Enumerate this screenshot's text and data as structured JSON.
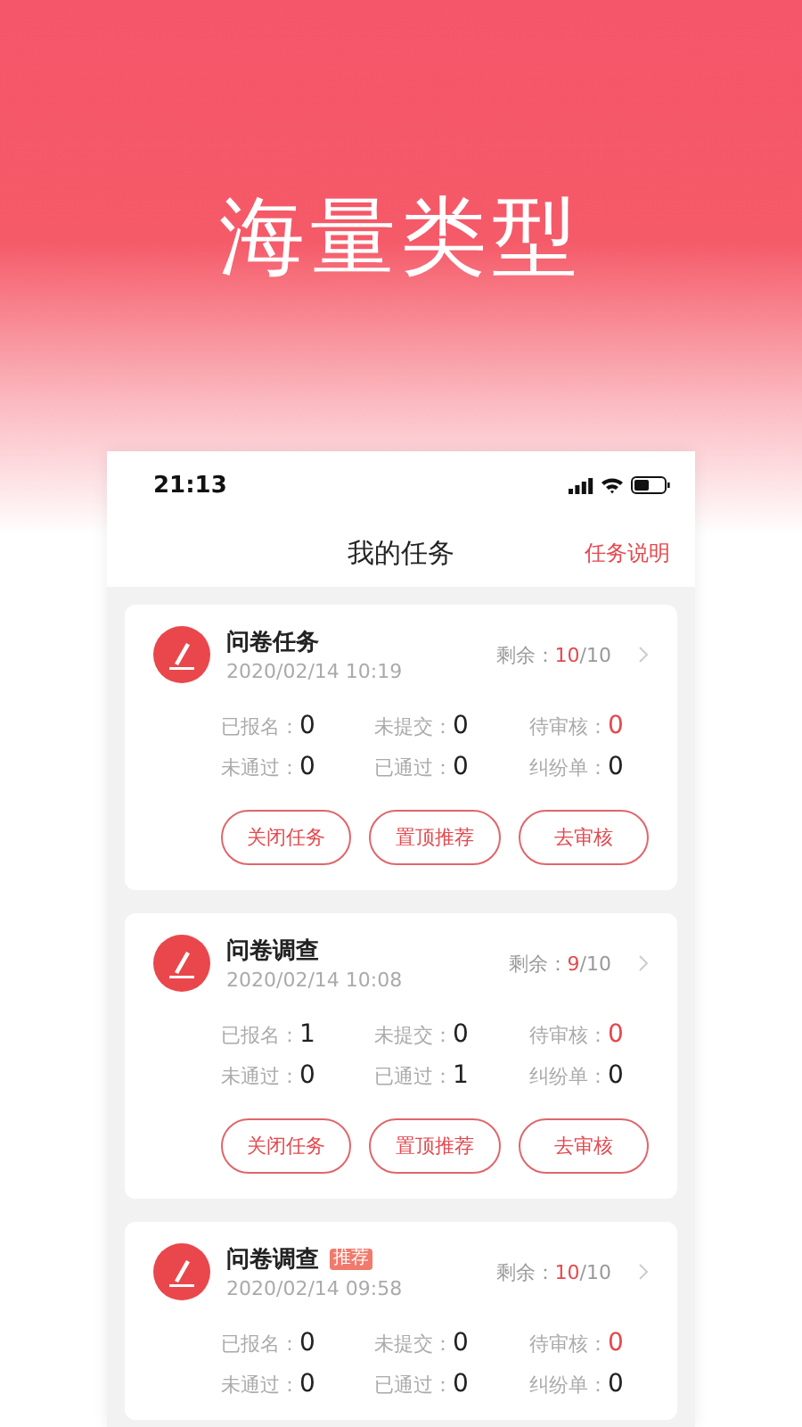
{
  "headline": "海量类型",
  "status_bar": {
    "time": "21:13"
  },
  "header": {
    "title": "我的任务",
    "action": "任务说明"
  },
  "tasks": [
    {
      "title": "问卷任务",
      "date": "2020/02/14 10:19",
      "remaining_label": "剩余：",
      "remaining_count": "10",
      "remaining_total": "/10",
      "stats": [
        {
          "label": "已报名：",
          "value": "0",
          "highlight": false
        },
        {
          "label": "未提交：",
          "value": "0",
          "highlight": false
        },
        {
          "label": "待审核：",
          "value": "0",
          "highlight": true
        },
        {
          "label": "未通过：",
          "value": "0",
          "highlight": false
        },
        {
          "label": "已通过：",
          "value": "0",
          "highlight": false
        },
        {
          "label": "纠纷单：",
          "value": "0",
          "highlight": false
        }
      ],
      "buttons": [
        "关闭任务",
        "置顶推荐",
        "去审核"
      ]
    },
    {
      "title": "问卷调查",
      "date": "2020/02/14 10:08",
      "remaining_label": "剩余：",
      "remaining_count": "9",
      "remaining_total": "/10",
      "stats": [
        {
          "label": "已报名：",
          "value": "1",
          "highlight": false
        },
        {
          "label": "未提交：",
          "value": "0",
          "highlight": false
        },
        {
          "label": "待审核：",
          "value": "0",
          "highlight": true
        },
        {
          "label": "未通过：",
          "value": "0",
          "highlight": false
        },
        {
          "label": "已通过：",
          "value": "1",
          "highlight": false
        },
        {
          "label": "纠纷单：",
          "value": "0",
          "highlight": false
        }
      ],
      "buttons": [
        "关闭任务",
        "置顶推荐",
        "去审核"
      ]
    },
    {
      "title": "问卷调查",
      "badge": "推荐",
      "date": "2020/02/14 09:58",
      "remaining_label": "剩余：",
      "remaining_count": "10",
      "remaining_total": "/10",
      "stats": [
        {
          "label": "已报名：",
          "value": "0",
          "highlight": false
        },
        {
          "label": "未提交：",
          "value": "0",
          "highlight": false
        },
        {
          "label": "待审核：",
          "value": "0",
          "highlight": true
        },
        {
          "label": "未通过：",
          "value": "0",
          "highlight": false
        },
        {
          "label": "已通过：",
          "value": "0",
          "highlight": false
        },
        {
          "label": "纠纷单：",
          "value": "0",
          "highlight": false
        }
      ]
    }
  ]
}
